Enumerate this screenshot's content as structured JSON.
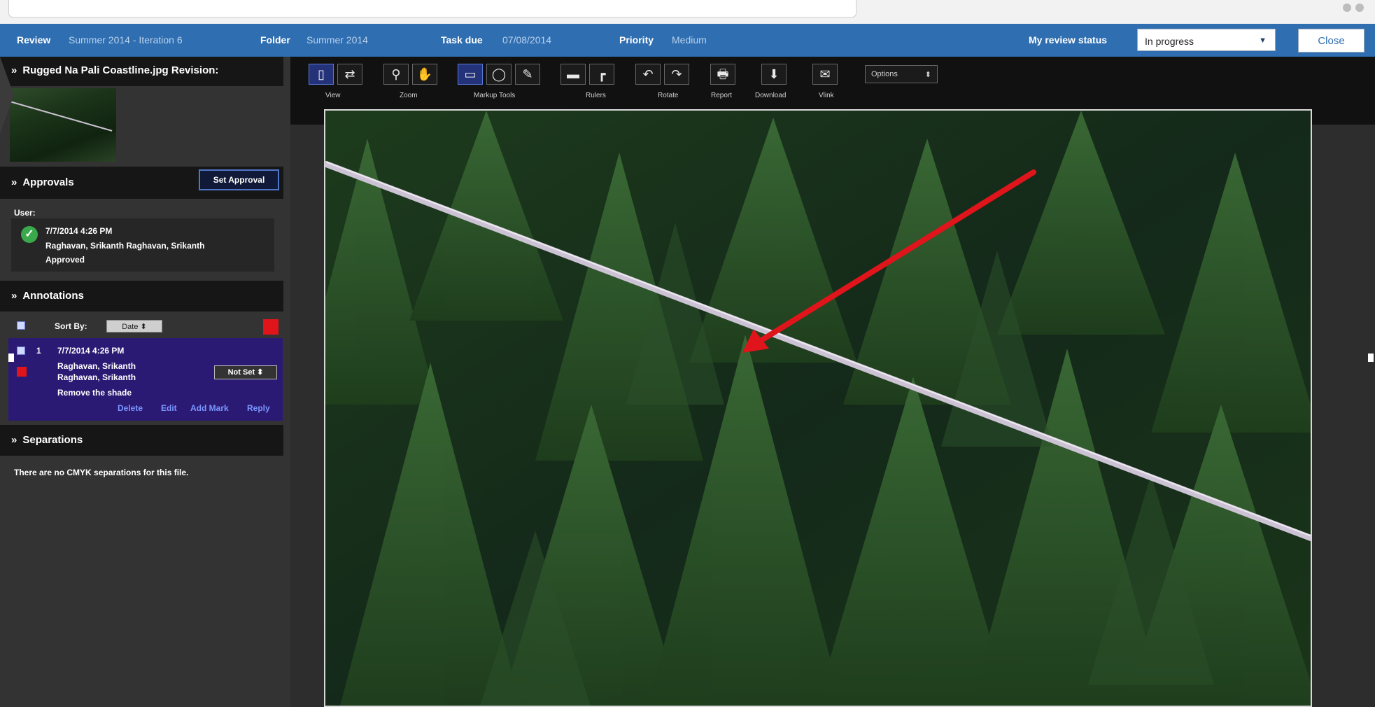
{
  "header": {
    "review_label": "Review",
    "review_value": "Summer 2014 - Iteration 6",
    "folder_label": "Folder",
    "folder_value": "Summer 2014",
    "task_due_label": "Task due",
    "task_due_value": "07/08/2014",
    "priority_label": "Priority",
    "priority_value": "Medium",
    "my_review_status_label": "My review status",
    "my_review_status_value": "In progress",
    "close_label": "Close"
  },
  "sidebar": {
    "file_header": "Rugged Na Pali Coastline.jpg Revision:",
    "approvals_header": "Approvals",
    "set_approval_label": "Set Approval",
    "user_label": "User:",
    "approval": {
      "timestamp": "7/7/2014 4:26 PM",
      "names": "Raghavan, Srikanth Raghavan, Srikanth",
      "status": "Approved"
    },
    "annotations_header": "Annotations",
    "sort_by_label": "Sort By:",
    "sort_by_value": "Date",
    "annotation": {
      "number": "1",
      "timestamp": "7/7/2014 4:26 PM",
      "name_line1": "Raghavan, Srikanth",
      "name_line2": "Raghavan, Srikanth",
      "comment": "Remove the shade",
      "status_value": "Not Set",
      "actions": [
        "Delete",
        "Edit",
        "Add Mark",
        "Reply"
      ]
    },
    "separations_header": "Separations",
    "separations_note": "There are no CMYK separations for this file."
  },
  "toolbar": {
    "captions": [
      "View",
      "Zoom",
      "Markup Tools",
      "Rulers",
      "Rotate",
      "Report",
      "Download",
      "Vlink"
    ],
    "options_label": "Options"
  },
  "colors": {
    "header_blue": "#2f6eb0",
    "annotation_purple": "#2b1a73",
    "markup_red": "#e0141b",
    "approved_green": "#3aa94c"
  },
  "icons": [
    "page-icon",
    "swap-icon",
    "magnifier-icon",
    "hand-icon",
    "rectangle-icon",
    "circle-icon",
    "pencil-icon",
    "ruler-h-icon",
    "ruler-v-icon",
    "rotate-left-icon",
    "rotate-right-icon",
    "report-icon",
    "download-icon",
    "mail-icon"
  ]
}
